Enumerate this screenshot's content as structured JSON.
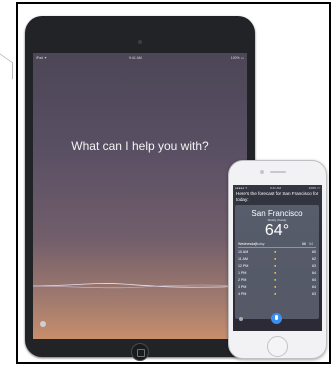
{
  "ipad": {
    "status_left": "iPad ✦",
    "status_center": "9:41 AM",
    "status_right": "100% ▭",
    "prompt": "What can I help you with?"
  },
  "iphone": {
    "status_left": "●●●●● ✦",
    "status_center": "9:41 AM",
    "status_right": "100% ▭",
    "response": "Here's the forecast for San Francisco for today:",
    "weather": {
      "city": "San Francisco",
      "subtitle": "Mostly Cloudy",
      "temperature": "64°",
      "day": "Wednesday",
      "today_label": "Today",
      "high": "66",
      "low": "54",
      "hours": [
        {
          "time": "10 AM",
          "temp": "60"
        },
        {
          "time": "11 AM",
          "temp": "62"
        },
        {
          "time": "12 PM",
          "temp": "63"
        },
        {
          "time": "1 PM",
          "temp": "64"
        },
        {
          "time": "2 PM",
          "temp": "64"
        },
        {
          "time": "3 PM",
          "temp": "64"
        },
        {
          "time": "4 PM",
          "temp": "63"
        }
      ]
    }
  }
}
